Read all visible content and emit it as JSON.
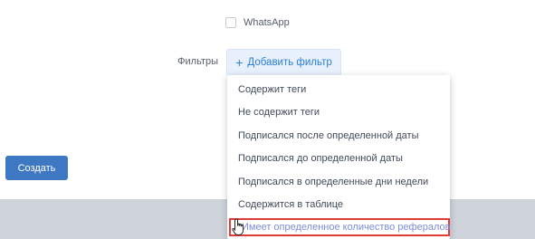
{
  "channels": {
    "whatsapp_label": "WhatsApp"
  },
  "filters": {
    "label": "Фильтры",
    "add_button_label": "Добавить фильтр",
    "menu_items": [
      "Содержит теги",
      "Не содержит теги",
      "Подписался после определенной даты",
      "Подписался до определенной даты",
      "Подписался в определенные дни недели",
      "Содержится в таблице",
      "Имеет определенное количество рефералов"
    ]
  },
  "actions": {
    "create_label": "Создать"
  },
  "colors": {
    "accent_blue": "#2d7fd6",
    "create_button": "#3f78c2",
    "highlight_border": "#e53935"
  },
  "icons": {
    "add_icon": "plus-icon",
    "cursor_icon": "hand-pointer-icon"
  }
}
